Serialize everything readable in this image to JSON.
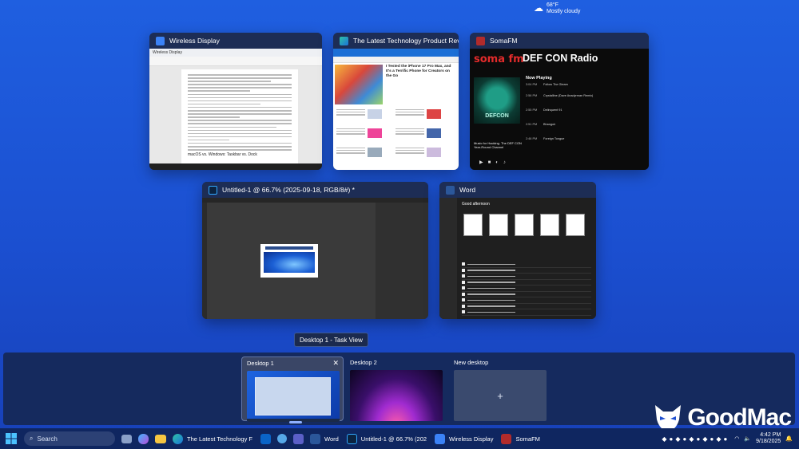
{
  "windows": {
    "wireless": {
      "title": "Wireless Display",
      "inner_tab": "Wireless Display",
      "heading": "macOS vs. Windows: Taskbar vs. Dock"
    },
    "tech": {
      "title": "The Latest Technology Product Reviews, New...",
      "headline": "I Tested the iPhone 17 Pro Max, and It's a Terrific Phone for Creators on the Go"
    },
    "soma": {
      "title": "SomaFM",
      "logo": "soma fm",
      "station": "DEF CON Radio",
      "now_playing": "Now Playing",
      "art_text": "DEFCON",
      "desc": "Music for Hacking. The DEF CON Year-Round Channel",
      "tracks": [
        {
          "time": "3:04 PM",
          "title": "Follow The Gleam"
        },
        {
          "time": "2:56 PM",
          "title": "Crystalline (Dave Anadyrman Remix)"
        },
        {
          "time": "2:55 PM",
          "title": "Delinquent 91"
        },
        {
          "time": "2:51 PM",
          "title": "Bhangoir"
        },
        {
          "time": "2:46 PM",
          "title": "Foreign Tongue"
        }
      ]
    },
    "photoshop": {
      "title": "Untitled-1 @ 66.7% (2025-09-18, RGB/8#) *"
    },
    "word": {
      "title": "Word",
      "greeting": "Good afternoon"
    }
  },
  "tooltip": "Desktop 1 - Task View",
  "desktops": [
    {
      "label": "Desktop 1",
      "close": "✕"
    },
    {
      "label": "Desktop 2"
    },
    {
      "label": "New desktop",
      "plus": "+"
    }
  ],
  "taskbar": {
    "search": "Search",
    "apps": [
      {
        "label": "The Latest Technology F",
        "icon": "edge-icon"
      },
      {
        "label": "Word",
        "icon": "word-icon"
      },
      {
        "label": "Untitled-1 @ 66.7% (202",
        "icon": "photoshop-icon"
      },
      {
        "label": "Wireless Display",
        "icon": "wireless-display-icon"
      },
      {
        "label": "SomaFM",
        "icon": "somafm-icon"
      }
    ],
    "weather_temp": "68°F",
    "weather_desc": "Mostly cloudy",
    "time": "4:42 PM",
    "date": "9/18/2025"
  },
  "watermark": "GoodMac",
  "colors": {
    "accent": "#1f5fe0",
    "taskbar": "#0f2660"
  }
}
